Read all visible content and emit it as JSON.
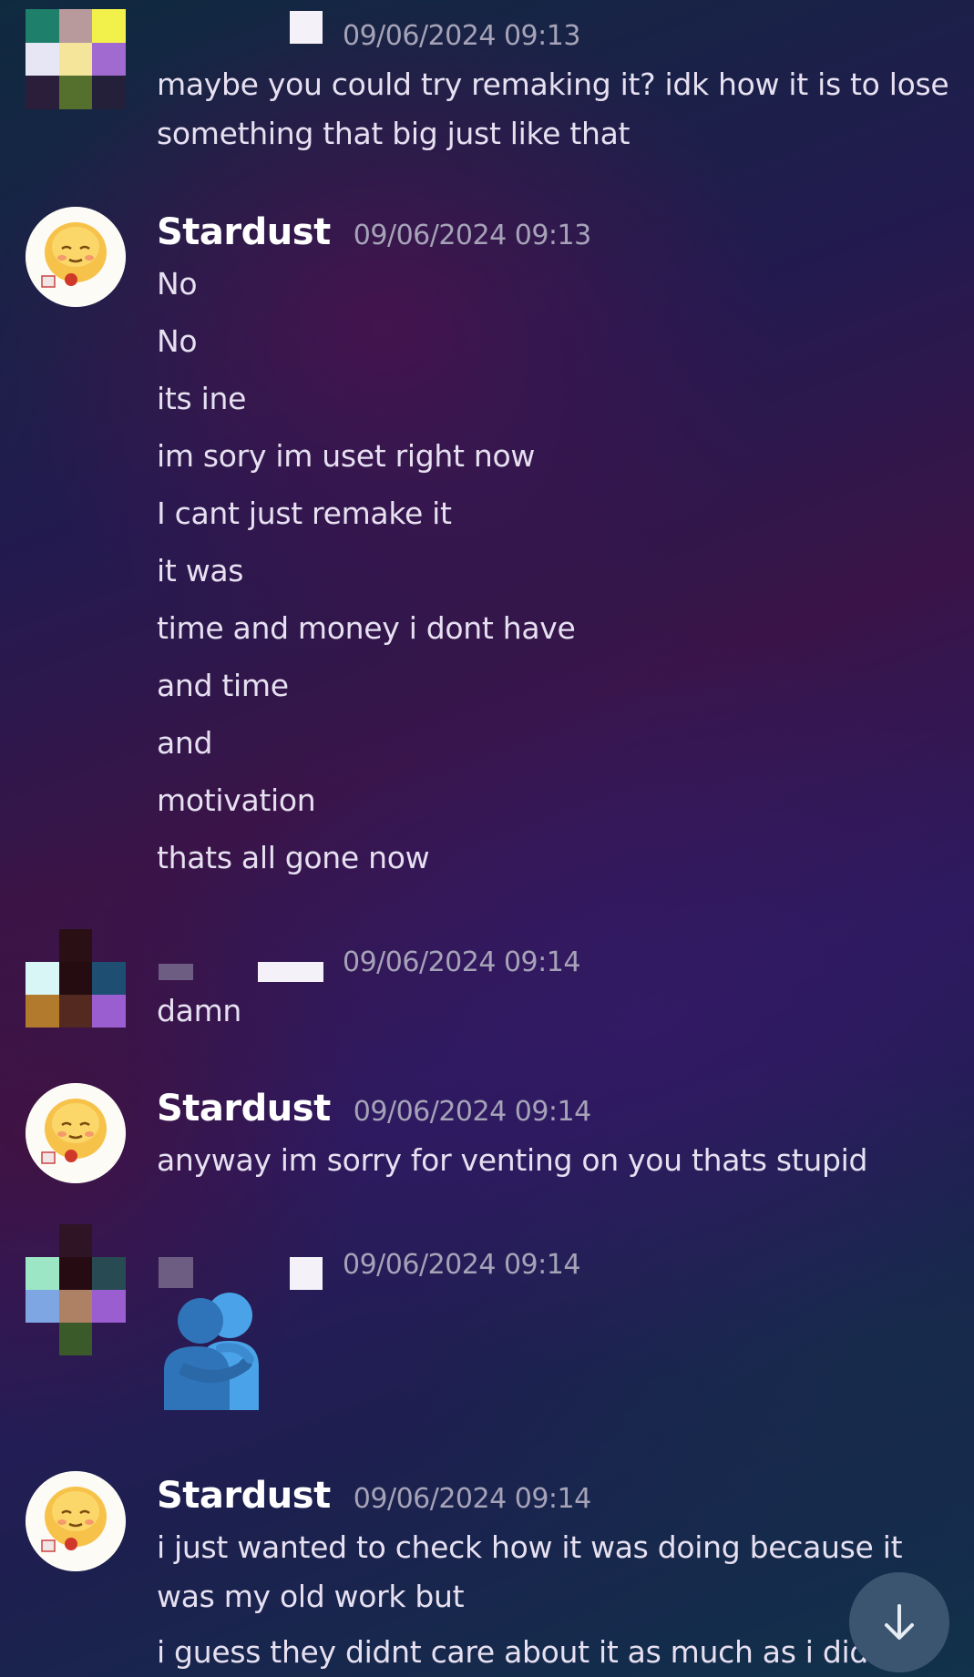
{
  "messages": [
    {
      "author": "",
      "timestamp": "09/06/2024 09:13",
      "lines": [
        "maybe you could try remaking it? idk how it is to lose",
        "something that big just like that"
      ]
    },
    {
      "author": "Stardust",
      "timestamp": "09/06/2024 09:13",
      "lines": [
        "No",
        "No",
        "its ine",
        "im sory im uset right now",
        "I cant just remake it",
        "it was",
        "time and money i dont have",
        "and time",
        "and",
        "motivation",
        "thats all gone now"
      ]
    },
    {
      "author": "",
      "timestamp": "09/06/2024 09:14",
      "lines": [
        "damn"
      ]
    },
    {
      "author": "Stardust",
      "timestamp": "09/06/2024 09:14",
      "lines": [
        "anyway im sorry for venting on you thats stupid"
      ]
    },
    {
      "author": "",
      "timestamp": "09/06/2024 09:14",
      "emoji": "people-hugging-emoji"
    },
    {
      "author": "Stardust",
      "timestamp": "09/06/2024 09:14",
      "lines": [
        "i just wanted to check how it was doing  because it",
        "was my old work but",
        "i guess they didnt care about it as much as i did"
      ]
    }
  ],
  "scroll_button": {
    "icon": "arrow-down-icon"
  },
  "colors": {
    "username": "#ffffff",
    "timestamp": "#a6a3b8",
    "message_text": "#e6e0f1",
    "hug_emoji": "#3d8fd6",
    "scroll_button_bg": "#3b5470"
  }
}
